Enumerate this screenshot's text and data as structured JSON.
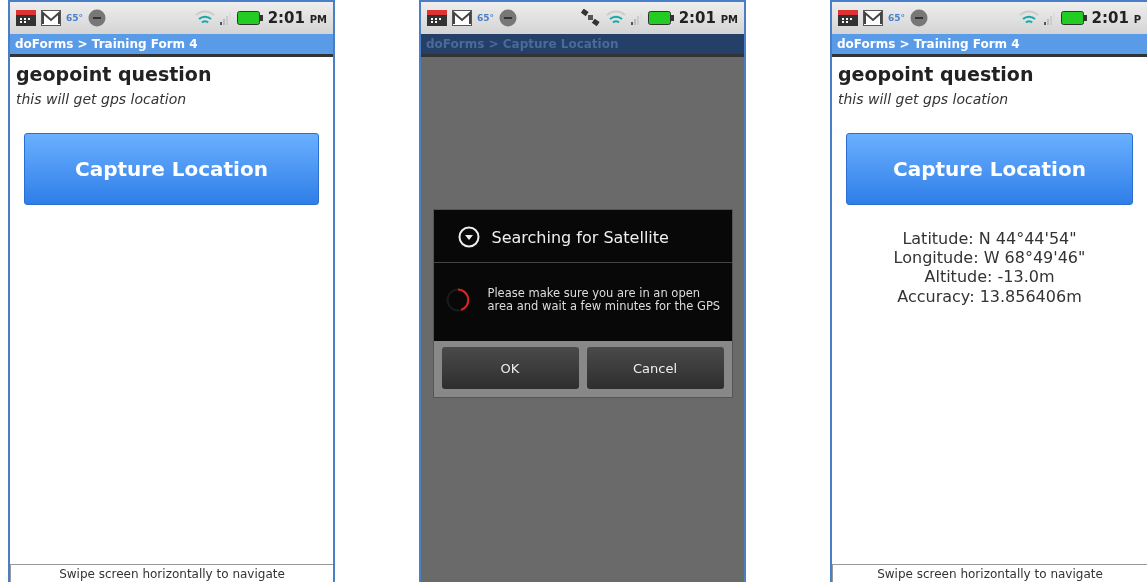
{
  "phones": [
    {
      "kind": "form",
      "status_bar": {
        "temperature": "65°",
        "gps": false,
        "time": "2:01",
        "ampm": "PM"
      },
      "title_bar": "doForms > Training Form 4",
      "question": "geopoint question",
      "hint": "this will get gps location",
      "button": "Capture Location",
      "footer": "Swipe screen horizontally to navigate"
    },
    {
      "kind": "dialog",
      "status_bar": {
        "temperature": "65°",
        "gps": true,
        "time": "2:01",
        "ampm": "PM"
      },
      "title_bar": "doForms > Capture Location",
      "dialog": {
        "title": "Searching for Satellite",
        "message": "Please make sure you are in an open area and wait a few minutes for the GPS",
        "buttons": [
          "OK",
          "Cancel"
        ]
      }
    },
    {
      "kind": "form",
      "status_bar": {
        "temperature": "65°",
        "gps": false,
        "time": "2:01",
        "ampm": "P"
      },
      "title_bar": "doForms > Training Form 4",
      "question": "geopoint question",
      "hint": "this will get gps location",
      "button": "Capture Location",
      "readings": [
        "Latitude: N 44°44'54\"",
        "Longitude: W 68°49'46\"",
        "Altitude: -13.0m",
        "Accuracy: 13.856406m"
      ],
      "footer": "Swipe screen horizontally to navigate"
    }
  ]
}
